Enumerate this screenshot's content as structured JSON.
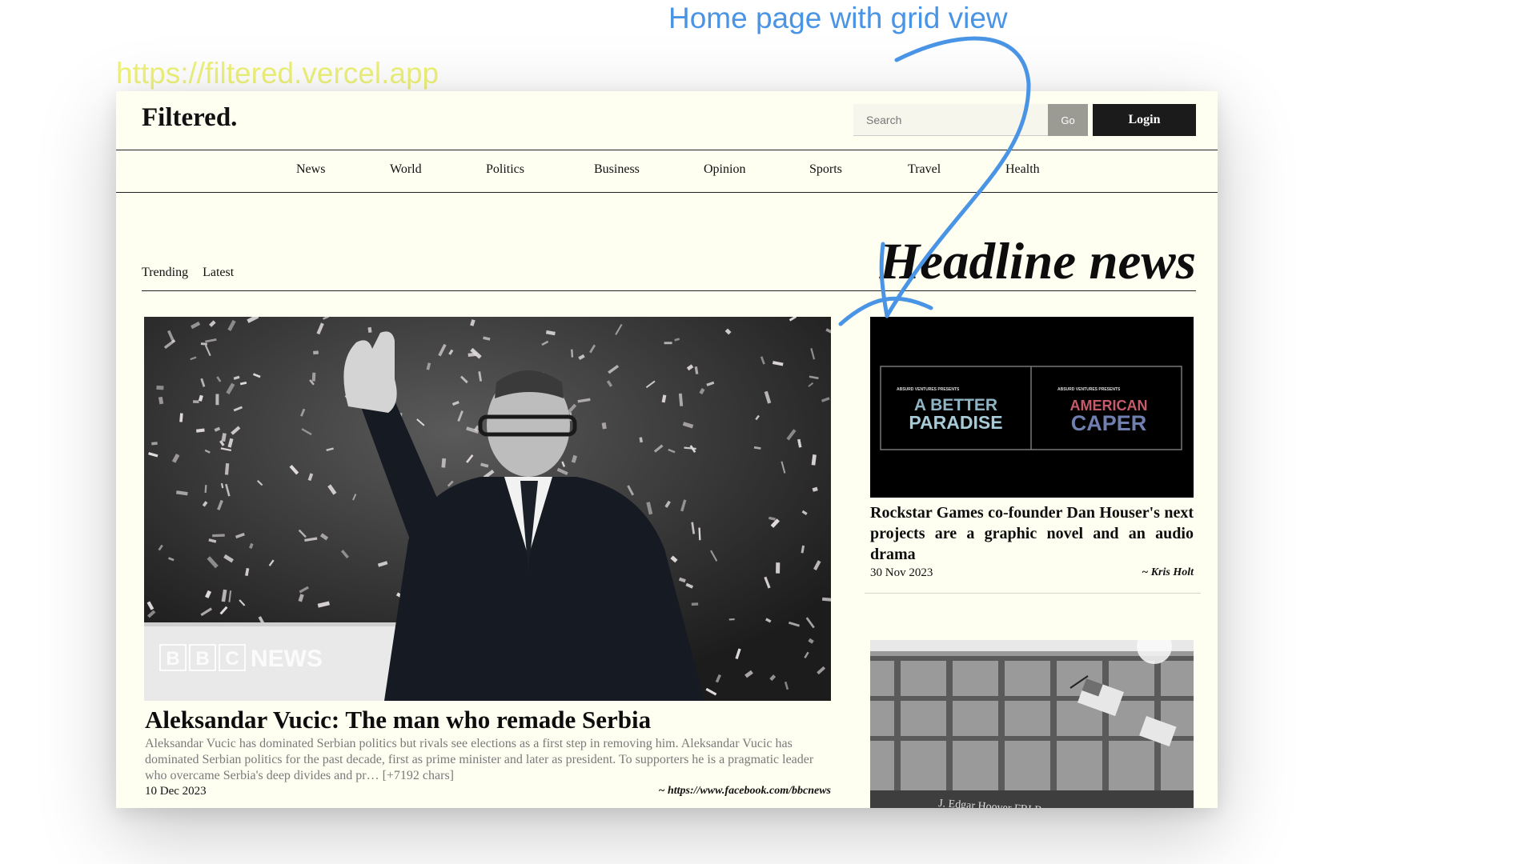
{
  "annotations": {
    "title": "Home page with grid view",
    "url": "https://filtered.vercel.app"
  },
  "header": {
    "logo": "Filtered.",
    "search_placeholder": "Search",
    "go_label": "Go",
    "login_label": "Login"
  },
  "nav": {
    "items": [
      "News",
      "World",
      "Politics",
      "Business",
      "Opinion",
      "Sports",
      "Travel",
      "Health"
    ]
  },
  "tabs": {
    "trending": "Trending",
    "latest": "Latest"
  },
  "section_title": "Headline news",
  "main_story": {
    "title": "Aleksandar Vucic: The man who remade Serbia",
    "description": "Aleksandar Vucic has dominated Serbian politics but rivals see elections as a first step in removing him. Aleksandar Vucic has dominated Serbian politics for the past decade, first as prime minister and later as president. To supporters he is a pragmatic leader who overcame Serbia's deep divides and pr… [+7192 chars]",
    "date": "10 Dec 2023",
    "source": "~ https://www.facebook.com/bbcnews",
    "image_watermark": [
      "B",
      "B",
      "C",
      "NEWS"
    ]
  },
  "side_stories": [
    {
      "title": "Rockstar Games co-founder Dan Houser's next projects are a graphic novel and an audio drama",
      "date": "30 Nov 2023",
      "author": "~ Kris Holt",
      "image_panels": [
        {
          "small": "ABSURD VENTURES PRESENTS",
          "line1": "A BETTER",
          "line2": "PARADISE"
        },
        {
          "small": "ABSURD VENTURES PRESENTS",
          "line1": "AMERICAN",
          "line2": "CAPER"
        }
      ]
    },
    {
      "image_sign": "J. Edgar Hoover FBI B..."
    }
  ]
}
